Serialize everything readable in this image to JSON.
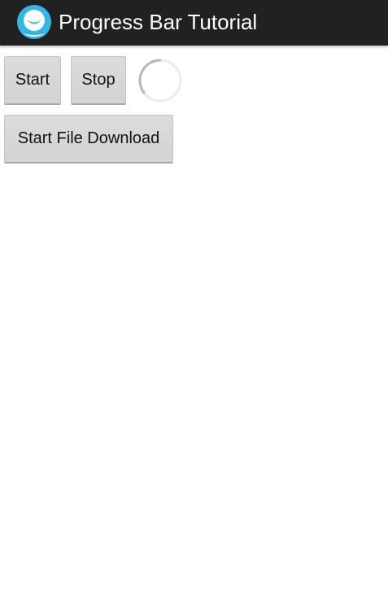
{
  "app": {
    "title": "Progress Bar Tutorial",
    "icon": "app-launcher-icon",
    "accent_color": "#33b5e5",
    "action_bar_color": "#212121"
  },
  "controls": {
    "start_label": "Start",
    "stop_label": "Stop",
    "download_label": "Start File Download"
  },
  "spinner": {
    "icon": "indeterminate-progress-spinner",
    "color": "#b8b8b8"
  }
}
